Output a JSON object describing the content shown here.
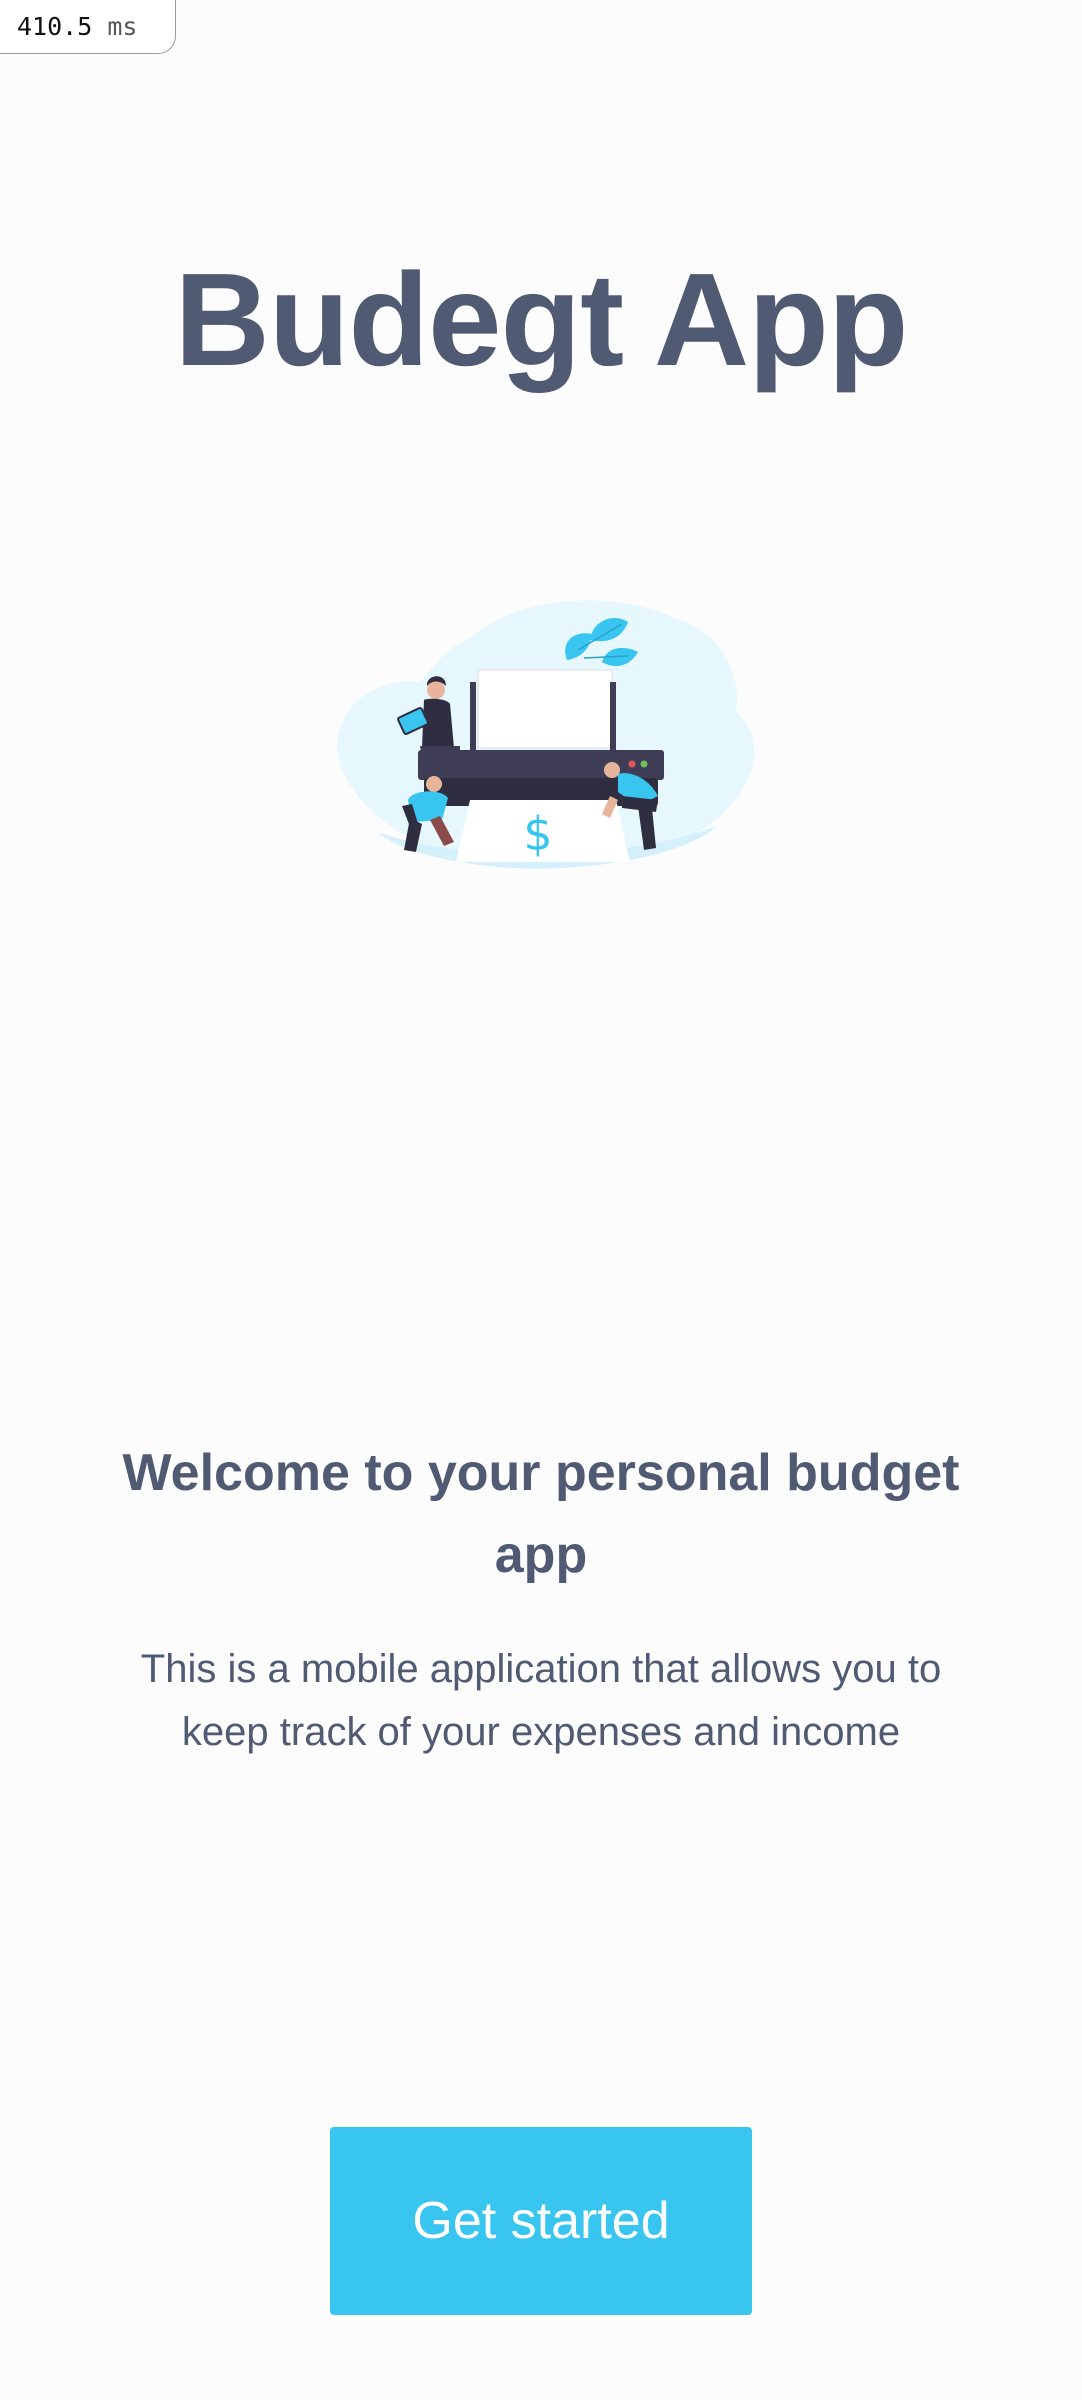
{
  "perf": {
    "value": "410.5",
    "unit": "ms"
  },
  "app": {
    "title": "Budegt App"
  },
  "hero": {
    "currency_symbol": "$",
    "illustration": "printer-printing-money-illustration"
  },
  "welcome": {
    "heading": "Welcome to your personal budget app",
    "description": "This is a mobile application that allows you to keep track of your expenses and income"
  },
  "cta": {
    "label": "Get started"
  },
  "colors": {
    "background": "#fcfcfc",
    "text": "#505a73",
    "accent": "#38c5f0",
    "illustration_bg": "#e6f7fd"
  }
}
